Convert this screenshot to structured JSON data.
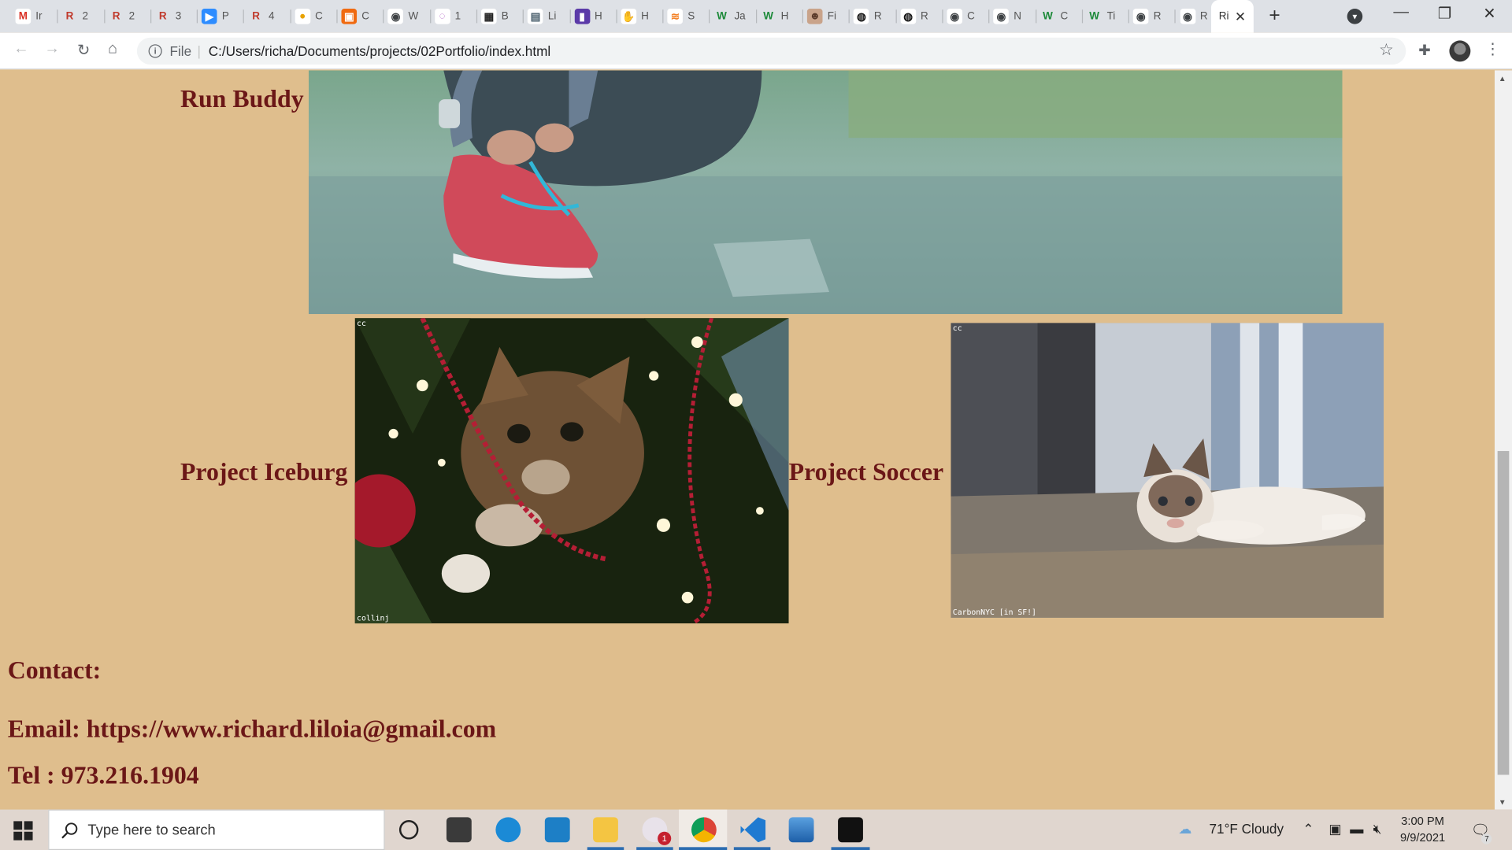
{
  "browser": {
    "tabs": [
      {
        "icon": "gmail-icon",
        "label": "Ir"
      },
      {
        "icon": "r-icon",
        "label": "2"
      },
      {
        "icon": "r-icon",
        "label": "2"
      },
      {
        "icon": "r-icon",
        "label": "3"
      },
      {
        "icon": "zoom-icon",
        "label": "P"
      },
      {
        "icon": "r-icon",
        "label": "4"
      },
      {
        "icon": "chrome-icon",
        "label": "C"
      },
      {
        "icon": "orange-icon",
        "label": "C"
      },
      {
        "icon": "globe-icon",
        "label": "W"
      },
      {
        "icon": "swirl-icon",
        "label": "1"
      },
      {
        "icon": "keyboard-icon",
        "label": "B"
      },
      {
        "icon": "doc-icon",
        "label": "Li"
      },
      {
        "icon": "purple-icon",
        "label": "H"
      },
      {
        "icon": "hand-icon",
        "label": "H"
      },
      {
        "icon": "stack-icon",
        "label": "S"
      },
      {
        "icon": "w-icon",
        "label": "Ja"
      },
      {
        "icon": "w-icon",
        "label": "H"
      },
      {
        "icon": "person-icon",
        "label": "Fi"
      },
      {
        "icon": "github-icon",
        "label": "R"
      },
      {
        "icon": "github-icon",
        "label": "R"
      },
      {
        "icon": "globe-icon",
        "label": "C"
      },
      {
        "icon": "globe-icon",
        "label": "N"
      },
      {
        "icon": "w-icon",
        "label": "C"
      },
      {
        "icon": "w-icon",
        "label": "Ti"
      },
      {
        "icon": "globe-icon",
        "label": "R"
      },
      {
        "icon": "globe-icon",
        "label": "R"
      }
    ],
    "active_tab": {
      "label": "Ri"
    },
    "address": {
      "scheme": "File",
      "url": "C:/Users/richa/Documents/projects/02Portfolio/index.html"
    }
  },
  "page": {
    "projects": [
      {
        "title": "Run Buddy"
      },
      {
        "title": "Project Iceburg",
        "caption_top": "cc",
        "caption_bottom": "collinj"
      },
      {
        "title": "Project Soccer",
        "caption_top": "cc",
        "caption_bottom": "CarbonNYC [in SF!]"
      }
    ],
    "contact": {
      "heading": "Contact:",
      "email": "Email: https://www.richard.liloia@gmail.com",
      "tel": "Tel : 973.216.1904"
    }
  },
  "taskbar": {
    "search_placeholder": "Type here to search",
    "weather": "71°F  Cloudy",
    "time": "3:00 PM",
    "date": "9/9/2021",
    "notification_count": "7",
    "slack_badge": "1"
  },
  "colors": {
    "page_bg": "#dfbe8d",
    "heading": "#6b1717"
  }
}
